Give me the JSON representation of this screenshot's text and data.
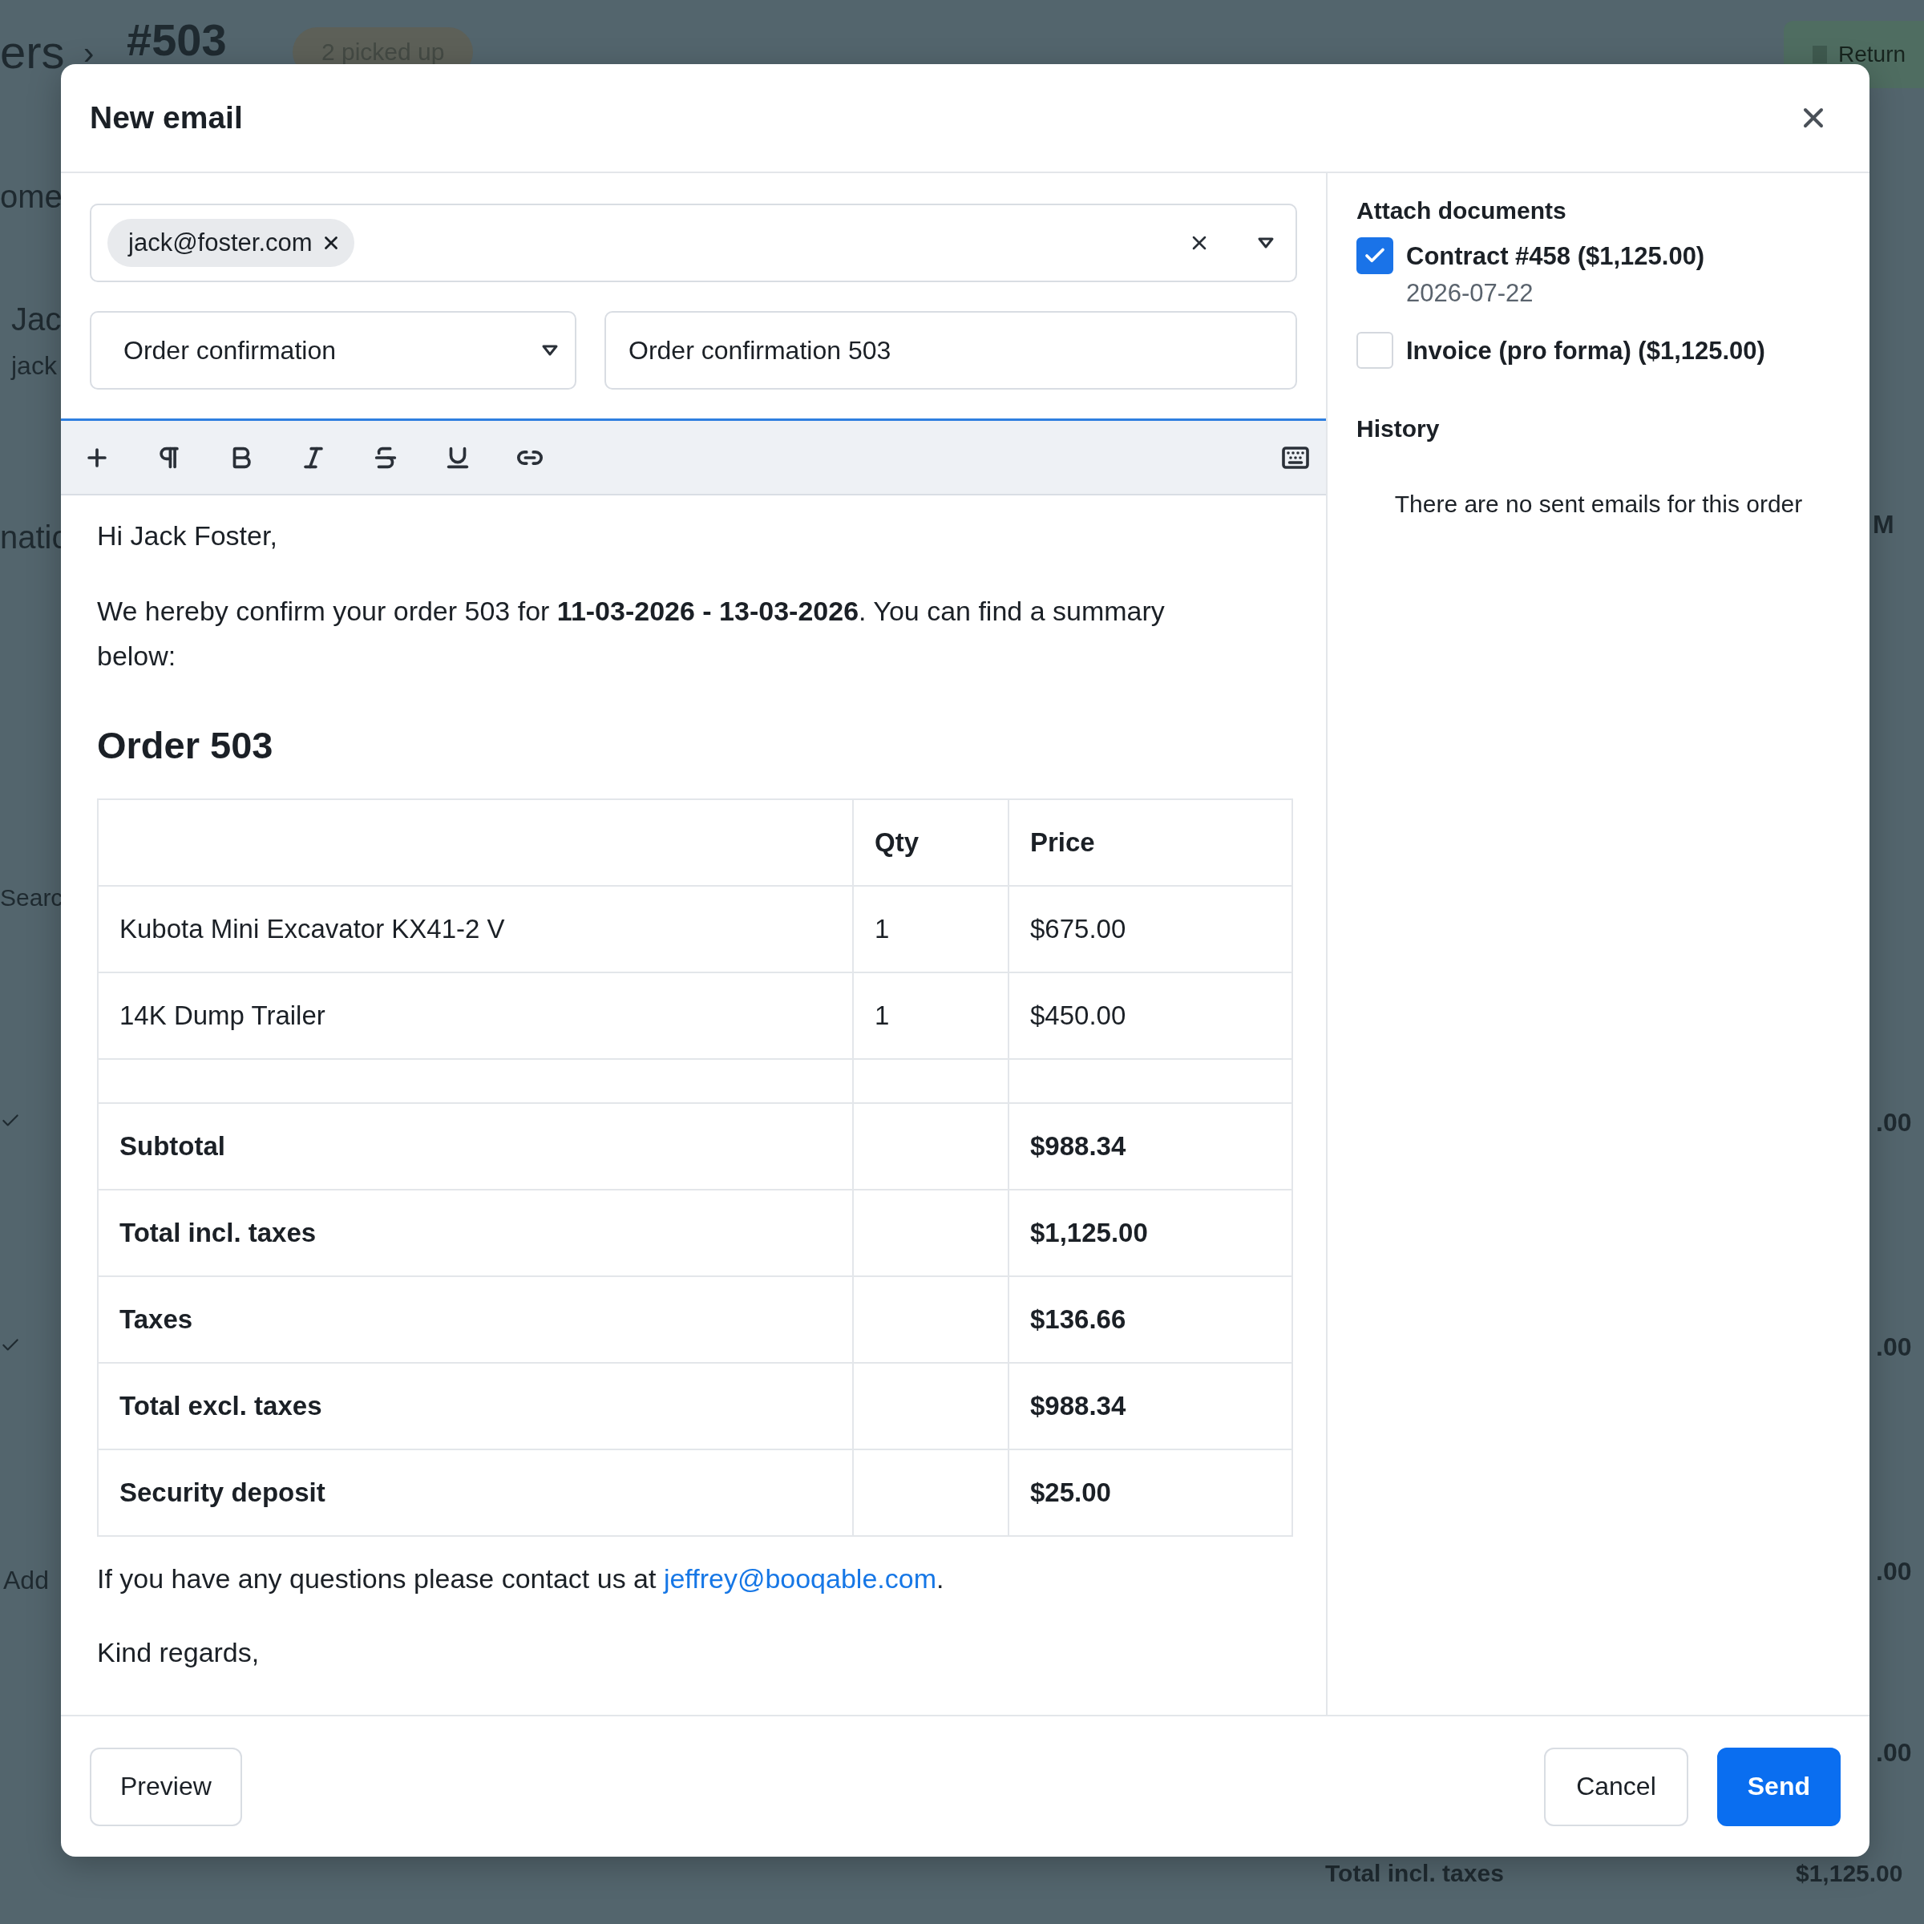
{
  "background_page": {
    "breadcrumb_start": "ers",
    "separator": "›",
    "order_number": "#503",
    "status_badge": "2 picked up",
    "return_button": "Return",
    "left_fragments": [
      {
        "kind": "text",
        "text": "ome"
      },
      {
        "kind": "text",
        "text": "Jac"
      },
      {
        "kind": "text",
        "text": "jack"
      },
      {
        "kind": "text",
        "text": "natic"
      },
      {
        "kind": "text",
        "text": "Searc"
      },
      {
        "kind": "check"
      },
      {
        "kind": "check"
      },
      {
        "kind": "text",
        "text": "Add"
      }
    ],
    "right_fragments": [
      {
        "text": "M"
      },
      {
        "text": ".00"
      },
      {
        "text": ".00"
      },
      {
        "text": ".00"
      },
      {
        "text": ".00"
      }
    ],
    "footer_label": "Total incl. taxes",
    "footer_value": "$1,125.00"
  },
  "dialog": {
    "title": "New email",
    "recipients": [
      {
        "email": "jack@foster.com"
      }
    ],
    "template": {
      "value": "Order confirmation"
    },
    "subject": {
      "value": "Order confirmation 503"
    },
    "body": {
      "greeting": "Hi Jack Foster,",
      "intro": "We hereby confirm your order 503 for **11-03-2026 - 13-03-2026**. You can find a summary below:",
      "heading": "Order 503",
      "table": {
        "columns": [
          "Qty",
          "Price"
        ],
        "items": [
          {
            "name": "Kubota Mini Excavator KX41-2 V",
            "qty": "1",
            "price": "$675.00"
          },
          {
            "name": "14K Dump Trailer",
            "qty": "1",
            "price": "$450.00"
          }
        ],
        "totals": [
          {
            "label": "Subtotal",
            "value": "$988.34"
          },
          {
            "label": "Total incl. taxes",
            "value": "$1,125.00"
          },
          {
            "label": "Taxes",
            "value": "$136.66"
          },
          {
            "label": "Total excl. taxes",
            "value": "$988.34"
          },
          {
            "label": "Security deposit",
            "value": "$25.00"
          }
        ]
      },
      "contact": {
        "before": "If you have any questions please contact us at",
        "link": "jeffrey@booqable.com",
        "after": "."
      },
      "closing": "Kind regards,"
    },
    "attach_title": "Attach documents",
    "attachments": [
      {
        "label": "Contract #458 ($1,125.00)",
        "date": "2026-07-22",
        "checked": true
      },
      {
        "label": "Invoice (pro forma) ($1,125.00)",
        "checked": false
      }
    ],
    "history_title": "History",
    "history_empty": "There are no sent emails for this order",
    "buttons": {
      "preview": "Preview",
      "cancel": "Cancel",
      "send": "Send"
    }
  }
}
